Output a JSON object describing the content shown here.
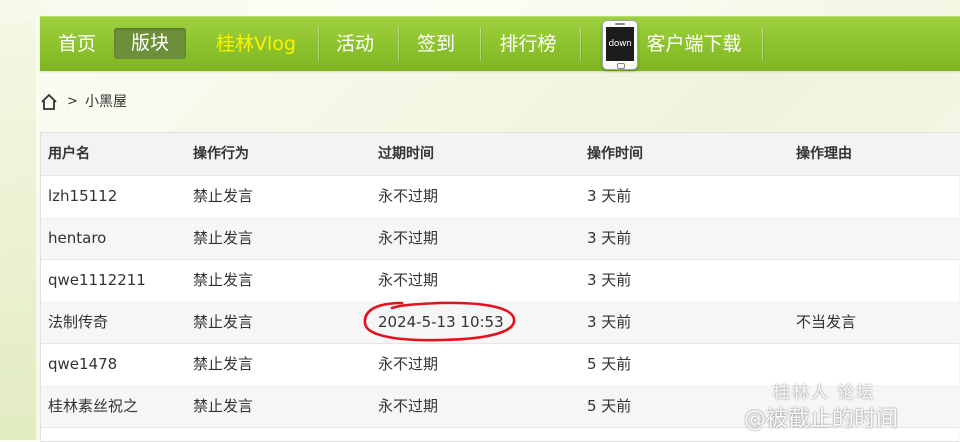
{
  "nav": {
    "items": [
      {
        "label": "首页"
      },
      {
        "label": "版块"
      },
      {
        "label": "桂林Vlog"
      },
      {
        "label": "活动"
      },
      {
        "label": "签到"
      },
      {
        "label": "排行榜"
      },
      {
        "label": "客户端下载"
      }
    ],
    "phone_icon_text": "down",
    "active_index": 1,
    "highlight_index": 2,
    "colors": {
      "bar": "#8cc22c",
      "active": "#6d8f3a",
      "highlight": "#fff200"
    }
  },
  "breadcrumb": {
    "home_icon": "home-icon",
    "separator": ">",
    "current": "小黑屋"
  },
  "table": {
    "headers": [
      "用户名",
      "操作行为",
      "过期时间",
      "操作时间",
      "操作理由"
    ],
    "rows": [
      {
        "user": "lzh15112",
        "action": "禁止发言",
        "expire": "永不过期",
        "time": "3 天前",
        "reason": ""
      },
      {
        "user": "hentaro",
        "action": "禁止发言",
        "expire": "永不过期",
        "time": "3 天前",
        "reason": ""
      },
      {
        "user": "qwe1112211",
        "action": "禁止发言",
        "expire": "永不过期",
        "time": "3 天前",
        "reason": ""
      },
      {
        "user": "法制传奇",
        "action": "禁止发言",
        "expire": "2024-5-13 10:53",
        "time": "3 天前",
        "reason": "不当发言"
      },
      {
        "user": "qwe1478",
        "action": "禁止发言",
        "expire": "永不过期",
        "time": "5 天前",
        "reason": ""
      },
      {
        "user": "桂林素丝祝之",
        "action": "禁止发言",
        "expire": "永不过期",
        "time": "5 天前",
        "reason": ""
      }
    ]
  },
  "watermark": {
    "line1": "桂林人 论坛",
    "line2": "@被截止的时间"
  }
}
